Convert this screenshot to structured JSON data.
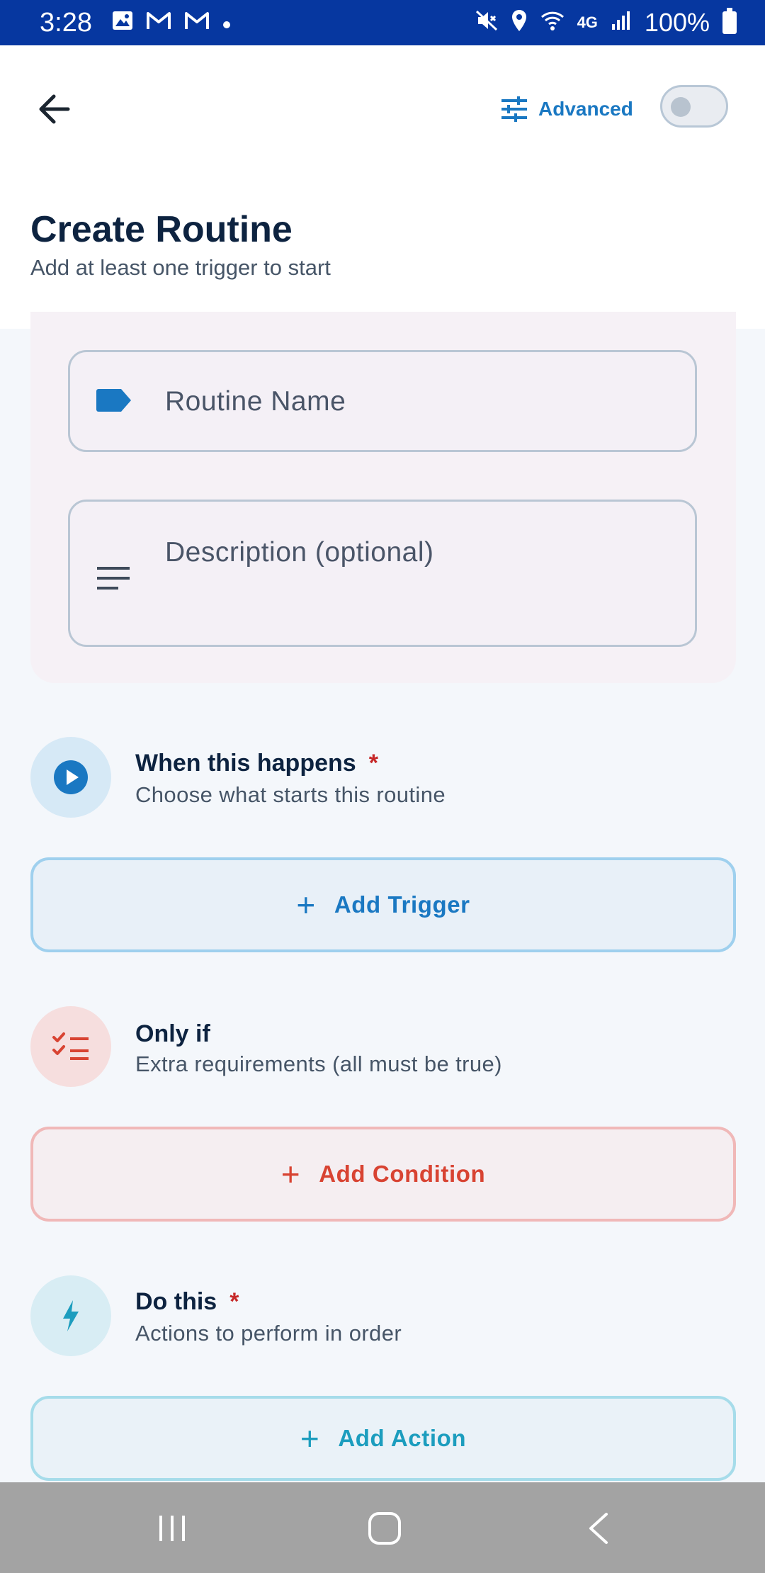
{
  "status_bar": {
    "time": "3:28",
    "battery": "100%",
    "network": "4G"
  },
  "header": {
    "advanced_label": "Advanced",
    "advanced_enabled": false,
    "title": "Create Routine",
    "subtitle": "Add at least one trigger to start"
  },
  "form": {
    "name_placeholder": "Routine Name",
    "description_placeholder": "Description (optional)"
  },
  "sections": {
    "trigger": {
      "title": "When this happens",
      "required": "*",
      "subtitle": "Choose what starts this routine",
      "button_label": "Add Trigger"
    },
    "condition": {
      "title": "Only if",
      "subtitle": "Extra requirements (all must be true)",
      "button_label": "Add Condition"
    },
    "action": {
      "title": "Do this",
      "required": "*",
      "subtitle": "Actions to perform in order",
      "button_label": "Add Action"
    }
  },
  "colors": {
    "status_bar": "#0637a0",
    "primary_blue": "#1a78c2",
    "condition_red": "#d84332",
    "action_teal": "#1c9dbe",
    "required_red": "#c62828"
  }
}
